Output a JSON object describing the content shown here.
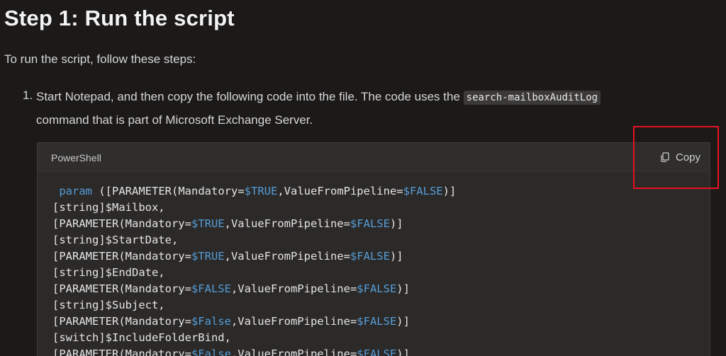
{
  "heading": "Step 1: Run the script",
  "intro": "To run the script, follow these steps:",
  "step": {
    "number": "1.",
    "text_before": "Start Notepad, and then copy the following code into the file. The code uses the ",
    "inline_code": "search-mailboxAuditLog",
    "text_after": "command that is part of Microsoft Exchange Server."
  },
  "code_block": {
    "language": "PowerShell",
    "copy_label": "Copy",
    "copy_icon": "copy-icon",
    "lines": [
      [
        {
          "t": " "
        },
        {
          "t": "param",
          "c": "kw"
        },
        {
          "t": " ([PARAMETER(Mandatory="
        },
        {
          "t": "$TRUE",
          "c": "var"
        },
        {
          "t": ",ValueFromPipeline="
        },
        {
          "t": "$FALSE",
          "c": "var"
        },
        {
          "t": ")]"
        }
      ],
      [
        {
          "t": "[string]$Mailbox,"
        }
      ],
      [
        {
          "t": "[PARAMETER(Mandatory="
        },
        {
          "t": "$TRUE",
          "c": "var"
        },
        {
          "t": ",ValueFromPipeline="
        },
        {
          "t": "$FALSE",
          "c": "var"
        },
        {
          "t": ")]"
        }
      ],
      [
        {
          "t": "[string]$StartDate,"
        }
      ],
      [
        {
          "t": "[PARAMETER(Mandatory="
        },
        {
          "t": "$TRUE",
          "c": "var"
        },
        {
          "t": ",ValueFromPipeline="
        },
        {
          "t": "$FALSE",
          "c": "var"
        },
        {
          "t": ")]"
        }
      ],
      [
        {
          "t": "[string]$EndDate,"
        }
      ],
      [
        {
          "t": "[PARAMETER(Mandatory="
        },
        {
          "t": "$FALSE",
          "c": "var"
        },
        {
          "t": ",ValueFromPipeline="
        },
        {
          "t": "$FALSE",
          "c": "var"
        },
        {
          "t": ")]"
        }
      ],
      [
        {
          "t": "[string]$Subject,"
        }
      ],
      [
        {
          "t": "[PARAMETER(Mandatory="
        },
        {
          "t": "$False",
          "c": "var"
        },
        {
          "t": ",ValueFromPipeline="
        },
        {
          "t": "$FALSE",
          "c": "var"
        },
        {
          "t": ")]"
        }
      ],
      [
        {
          "t": "[switch]$IncludeFolderBind,"
        }
      ],
      [
        {
          "t": "[PARAMETER(Mandatory="
        },
        {
          "t": "$False",
          "c": "var"
        },
        {
          "t": ",ValueFromPipeline="
        },
        {
          "t": "$FALSE",
          "c": "var"
        },
        {
          "t": ")]"
        }
      ]
    ]
  },
  "colors": {
    "background": "#1b1a19",
    "code_background": "#2b2a29",
    "keyword": "#569cd6",
    "highlight_border": "#e81123"
  }
}
